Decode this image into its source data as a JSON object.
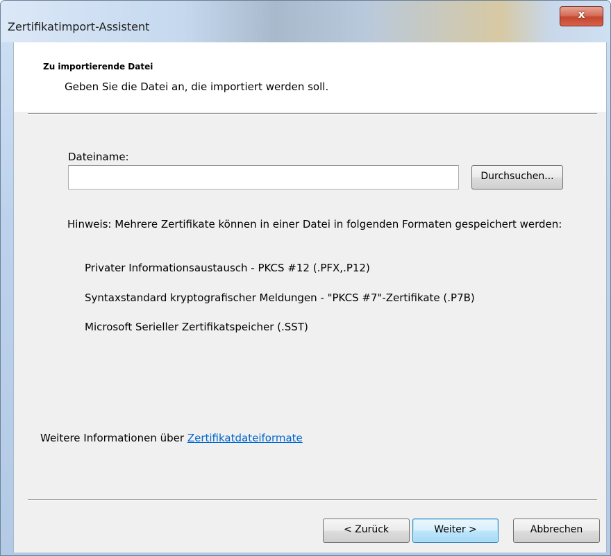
{
  "window": {
    "title": "Zertifikatimport-Assistent",
    "close_glyph": "x"
  },
  "header": {
    "title": "Zu importierende Datei",
    "subtitle": "Geben Sie die Datei an, die importiert werden soll."
  },
  "file": {
    "label": "Dateiname:",
    "value": "",
    "browse_label": "Durchsuchen..."
  },
  "hint": {
    "text": "Hinweis: Mehrere Zertifikate können in einer Datei in folgenden Formaten gespeichert werden:",
    "formats": [
      "Privater Informationsaustausch - PKCS #12 (.PFX,.P12)",
      "Syntaxstandard kryptografischer Meldungen - \"PKCS #7\"-Zertifikate (.P7B)",
      "Microsoft Serieller Zertifikatspeicher (.SST)"
    ]
  },
  "more_info": {
    "prefix": "Weitere Informationen über ",
    "link": "Zertifikatdateiformate"
  },
  "buttons": {
    "back": "< Zurück",
    "next": "Weiter >",
    "cancel": "Abbrechen"
  }
}
